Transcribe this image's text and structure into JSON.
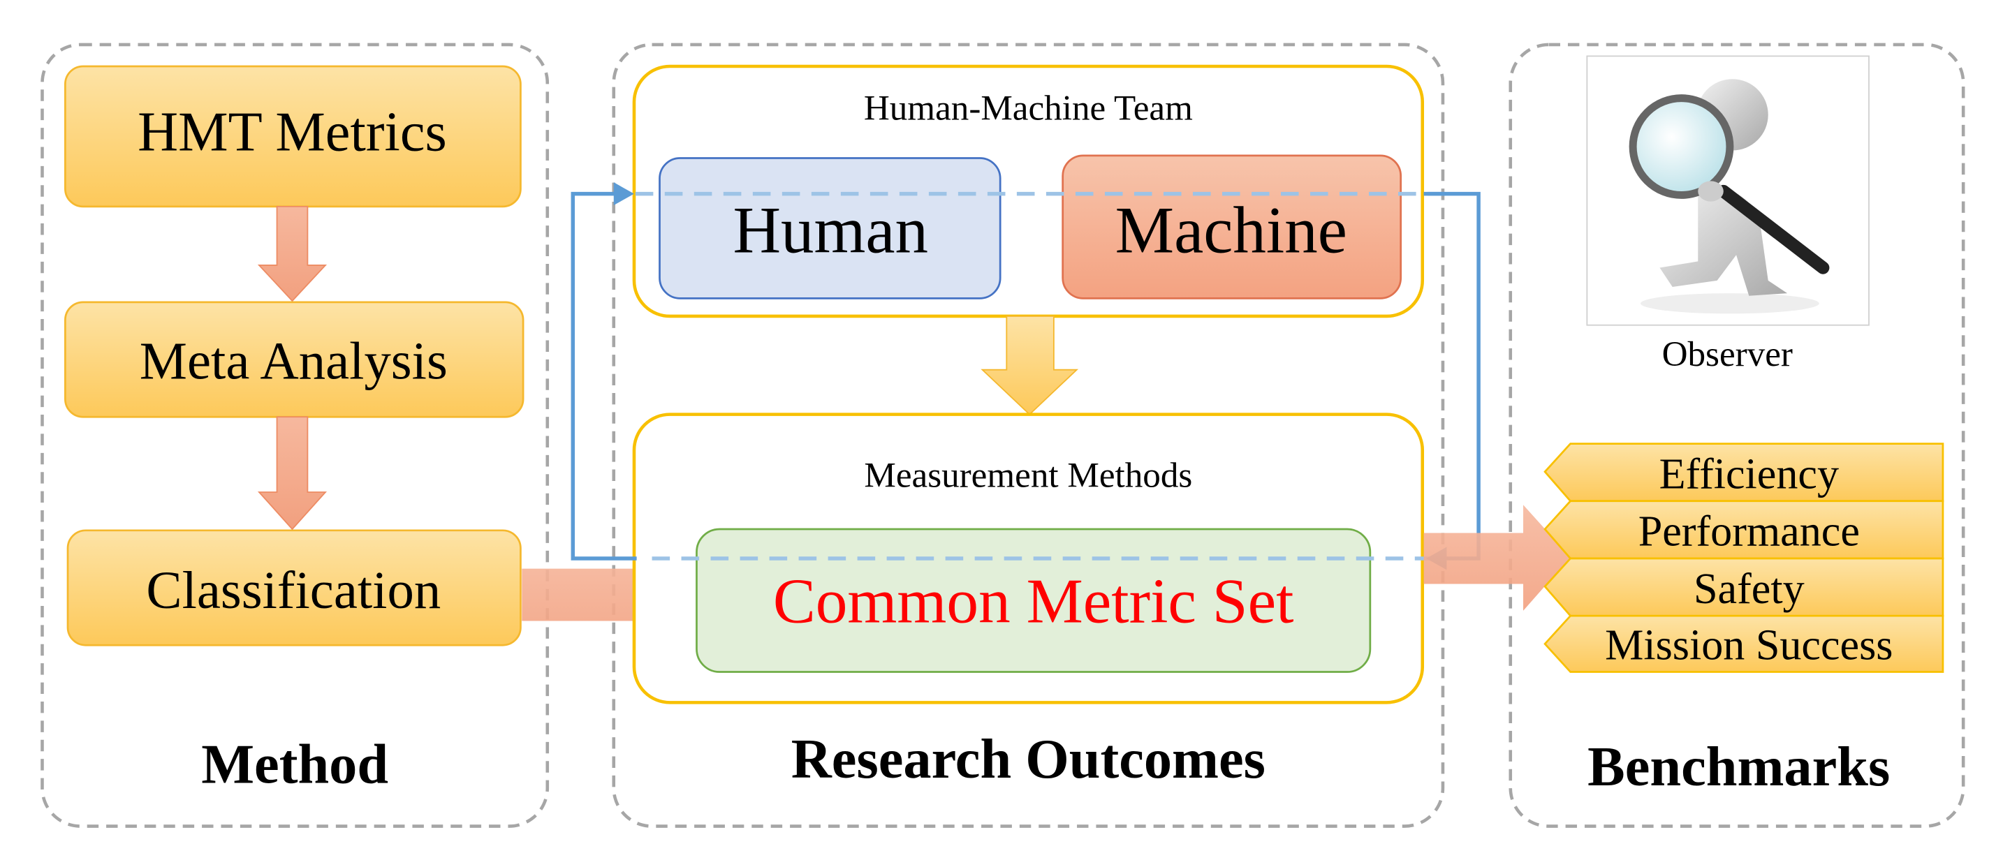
{
  "method": {
    "title": "Method",
    "steps": [
      "HMT Metrics",
      "Meta Analysis",
      "Classification"
    ]
  },
  "research": {
    "title": "Research Outcomes",
    "team": {
      "title": "Human-Machine Team",
      "human": "Human",
      "machine": "Machine"
    },
    "measurement": {
      "title": "Measurement Methods",
      "common": "Common Metric Set"
    }
  },
  "benchmarks": {
    "title": "Benchmarks",
    "observer": "Observer",
    "observer_icon": "person-with-magnifying-glass-icon",
    "items": [
      "Efficiency",
      "Performance",
      "Safety",
      "Mission Success"
    ]
  },
  "colors": {
    "step_fill": "#fdd68a",
    "step_stroke": "#f5b82e",
    "arrow_orange": "#f4a585",
    "arrow_yellow": "#fdd36b",
    "team_stroke": "#f8c000",
    "human_fill": "#dae3f3",
    "human_stroke": "#4472c4",
    "machine_fill": "#f5ad8d",
    "common_fill": "#e2efd9",
    "common_stroke": "#70ad47",
    "common_text": "#ff0000",
    "loop_solid": "#5b9bd5",
    "loop_dashed": "#9dc3e6",
    "panel_border": "#a6a6a6"
  }
}
